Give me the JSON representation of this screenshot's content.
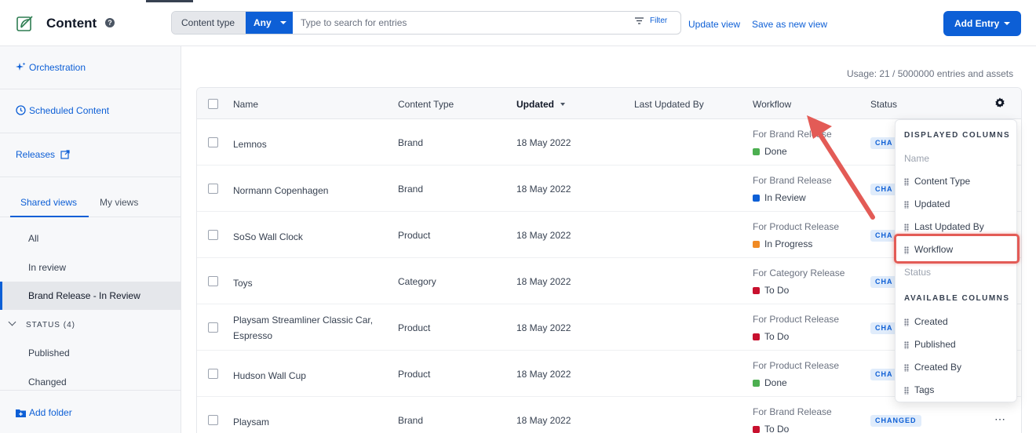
{
  "header": {
    "title": "Content",
    "help_icon": "?",
    "content_type_label": "Content type",
    "content_type_value": "Any",
    "search_placeholder": "Type to search for entries",
    "filter_label": "Filter",
    "update_view": "Update view",
    "save_as_new_view": "Save as new view",
    "add_entry": "Add Entry"
  },
  "sidebar": {
    "orchestration": "Orchestration",
    "scheduled_content": "Scheduled Content",
    "releases": "Releases",
    "tabs": [
      "Shared views",
      "My views"
    ],
    "views": [
      "All",
      "In review",
      "Brand Release - In Review"
    ],
    "status_group": "STATUS (4)",
    "status_items": [
      "Published",
      "Changed"
    ],
    "add_folder": "Add folder"
  },
  "usage": "Usage: 21 / 5000000 entries and assets",
  "table": {
    "columns": [
      "Name",
      "Content Type",
      "Updated",
      "Last Updated By",
      "Workflow",
      "Status"
    ],
    "rows": [
      {
        "name": "Lemnos",
        "name2": "",
        "type": "Brand",
        "updated": "18 May 2022",
        "wf_name": "For Brand Release",
        "wf_status": "Done",
        "wf_color": "#4caf50",
        "badge": "CHA"
      },
      {
        "name": "Normann Copenhagen",
        "name2": "",
        "type": "Brand",
        "updated": "18 May 2022",
        "wf_name": "For Brand Release",
        "wf_status": "In Review",
        "wf_color": "#0d5fd6",
        "badge": "CHA"
      },
      {
        "name": "SoSo Wall Clock",
        "name2": "",
        "type": "Product",
        "updated": "18 May 2022",
        "wf_name": "For Product Release",
        "wf_status": "In Progress",
        "wf_color": "#f08a24",
        "badge": "CHA"
      },
      {
        "name": "Toys",
        "name2": "",
        "type": "Category",
        "updated": "18 May 2022",
        "wf_name": "For Category Release",
        "wf_status": "To Do",
        "wf_color": "#c8102e",
        "badge": "CHA"
      },
      {
        "name": "Playsam Streamliner Classic Car,",
        "name2": "Espresso",
        "type": "Product",
        "updated": "18 May 2022",
        "wf_name": "For Product Release",
        "wf_status": "To Do",
        "wf_color": "#c8102e",
        "badge": "CHA"
      },
      {
        "name": "Hudson Wall Cup",
        "name2": "",
        "type": "Product",
        "updated": "18 May 2022",
        "wf_name": "For Product Release",
        "wf_status": "Done",
        "wf_color": "#4caf50",
        "badge": "CHA"
      },
      {
        "name": "Playsam",
        "name2": "",
        "type": "Brand",
        "updated": "18 May 2022",
        "wf_name": "For Brand Release",
        "wf_status": "To Do",
        "wf_color": "#c8102e",
        "badge": "CHANGED"
      }
    ]
  },
  "picker": {
    "displayed_heading": "DISPLAYED COLUMNS",
    "displayed": [
      {
        "label": "Name",
        "draggable": false
      },
      {
        "label": "Content Type",
        "draggable": true
      },
      {
        "label": "Updated",
        "draggable": true
      },
      {
        "label": "Last Updated By",
        "draggable": true
      },
      {
        "label": "Workflow",
        "draggable": true
      },
      {
        "label": "Status",
        "draggable": false
      }
    ],
    "available_heading": "AVAILABLE COLUMNS",
    "available": [
      "Created",
      "Published",
      "Created By",
      "Tags"
    ]
  },
  "colors": {
    "accent": "#0d5fd6",
    "annotation": "#e35b56"
  },
  "icons": {
    "more": "more-horizontal-icon",
    "settings": "gear-icon"
  }
}
